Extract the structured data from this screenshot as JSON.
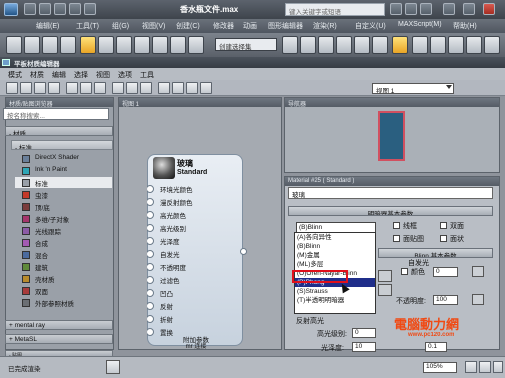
{
  "app": {
    "title": "香水瓶文件.max",
    "search_placeholder": "键入关键字或短语"
  },
  "main_menu": [
    "编辑(E)",
    "工具(T)",
    "组(G)",
    "视图(V)",
    "创建(C)",
    "修改器",
    "动画",
    "图形编辑器",
    "渲染(R)",
    "自定义(U)",
    "MAXScript(M)",
    "帮助(H)"
  ],
  "toolbar": {
    "selection_dropdown": "创建选择集"
  },
  "sme": {
    "title": "平板材质编辑器",
    "menu": [
      "模式",
      "材质",
      "编辑",
      "选择",
      "视图",
      "选项",
      "工具"
    ],
    "view_dropdown": "视图 1"
  },
  "browser": {
    "header": "材质/贴图浏览器",
    "search_placeholder": "按名称搜索...",
    "group_materials": "- 材质",
    "subgroup_standard": "- 标准",
    "items": [
      {
        "label": "DirectX Shader",
        "color": "#6a7f99"
      },
      {
        "label": "Ink 'n Paint",
        "color": "#2ea5b5"
      },
      {
        "label": "标准",
        "color": "#9aa0a8"
      },
      {
        "label": "虫漆",
        "color": "#c43a2a"
      },
      {
        "label": "顶/底",
        "color": "#7a3c3c"
      },
      {
        "label": "多维/子对象",
        "color": "#a4356b"
      },
      {
        "label": "光线跟踪",
        "color": "#8c5ba5"
      },
      {
        "label": "合成",
        "color": "#a35ab2"
      },
      {
        "label": "混合",
        "color": "#4a6a9e"
      },
      {
        "label": "建筑",
        "color": "#5f8a3a"
      },
      {
        "label": "壳材质",
        "color": "#b88b2c"
      },
      {
        "label": "双面",
        "color": "#a83b3b"
      },
      {
        "label": "外部参照材质",
        "color": "#6b6f74"
      }
    ],
    "group_mental_ray": "+ mental ray",
    "group_metasl": "+ MetaSL",
    "group_maps": "- 贴图"
  },
  "view_pane": {
    "header": "视图 1"
  },
  "node": {
    "title": "玻璃",
    "subtitle": "Standard",
    "slots": [
      "环境光颜色",
      "漫反射颜色",
      "高光颜色",
      "高光级别",
      "光泽度",
      "自发光",
      "不透明度",
      "过滤色",
      "凹凸",
      "反射",
      "折射",
      "置换"
    ],
    "footer_params": "附加参数",
    "footer_mr": "mr 连接"
  },
  "nav_pane": {
    "header": "导航器"
  },
  "params": {
    "header": "Material #25 ( Standard )",
    "name": "玻璃",
    "rollout_basic": "明暗器基本参数",
    "shader_selected": "(B)Blinn",
    "wire": "线框",
    "two_sided": "双面",
    "face_map": "面贴图",
    "faceted": "面状",
    "shader_options": [
      "(A)各向异性",
      "(B)Blinn",
      "(M)金属",
      "(ML)多层",
      "(O)Oren-Nayar-Blinn",
      "(P)Phong",
      "(S)Strauss",
      "(T)半透明明暗器"
    ],
    "shader_highlight_index": 5,
    "rollout_blinn": "Blinn 基本参数",
    "self_illum": "自发光",
    "color_label": "颜色",
    "self_illum_value": "0",
    "opacity_label": "不透明度:",
    "opacity_value": "100",
    "specular_group": "反射高光",
    "specular_level_label": "高光级别:",
    "specular_level_value": "0",
    "glossiness_label": "光泽度:",
    "glossiness_value": "10",
    "soften_value": "0.1",
    "ambient_label": "环境光:",
    "diffuse_label": "漫反射:",
    "specular_label": "高光反射:"
  },
  "status": {
    "text": "已完成渲染",
    "zoom": "105%"
  },
  "watermark": {
    "logo": "電腦動力網",
    "url": "www.pc120.com"
  }
}
